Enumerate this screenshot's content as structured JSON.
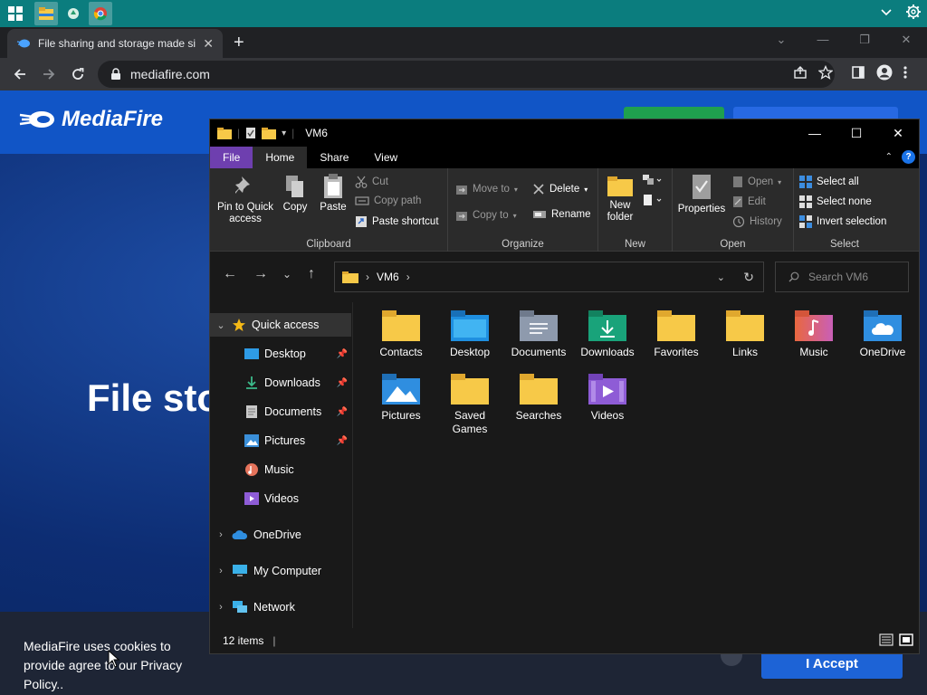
{
  "taskbar": {
    "apps": [
      {
        "name": "file-explorer",
        "active": true
      },
      {
        "name": "recycle",
        "active": false
      },
      {
        "name": "chrome",
        "active": true
      }
    ]
  },
  "browser": {
    "tab_title": "File sharing and storage made si",
    "url": "mediafire.com"
  },
  "page": {
    "logo_text": "MediaFire",
    "hero_title": "File sto",
    "cookie_text": "MediaFire uses cookies to provide agree to our Privacy Policy..",
    "accept_label": "I Accept"
  },
  "explorer": {
    "title": "VM6",
    "ribbon_tabs": [
      "File",
      "Home",
      "Share",
      "View"
    ],
    "clipboard": {
      "pin_label": "Pin to Quick access",
      "copy_label": "Copy",
      "paste_label": "Paste",
      "cut_label": "Cut",
      "copy_path_label": "Copy path",
      "paste_shortcut_label": "Paste shortcut",
      "group_label": "Clipboard"
    },
    "organize": {
      "move_to_label": "Move to",
      "copy_to_label": "Copy to",
      "delete_label": "Delete",
      "rename_label": "Rename",
      "group_label": "Organize"
    },
    "new": {
      "new_folder_label": "New folder",
      "group_label": "New"
    },
    "open": {
      "properties_label": "Properties",
      "open_label": "Open",
      "edit_label": "Edit",
      "history_label": "History",
      "group_label": "Open"
    },
    "select": {
      "select_all_label": "Select all",
      "select_none_label": "Select none",
      "invert_label": "Invert selection",
      "group_label": "Select"
    },
    "address": {
      "path": "VM6",
      "search_placeholder": "Search VM6"
    },
    "nav": [
      {
        "label": "Quick access",
        "selected": true
      },
      {
        "label": "Desktop"
      },
      {
        "label": "Downloads"
      },
      {
        "label": "Documents"
      },
      {
        "label": "Pictures"
      },
      {
        "label": "Music"
      },
      {
        "label": "Videos"
      },
      {
        "label": "OneDrive"
      },
      {
        "label": "My Computer"
      },
      {
        "label": "Network"
      }
    ],
    "items": [
      {
        "label": "Contacts",
        "icon": "contacts-folder-icon"
      },
      {
        "label": "Desktop",
        "icon": "desktop-folder-icon"
      },
      {
        "label": "Documents",
        "icon": "documents-folder-icon"
      },
      {
        "label": "Downloads",
        "icon": "downloads-folder-icon"
      },
      {
        "label": "Favorites",
        "icon": "favorites-folder-icon"
      },
      {
        "label": "Links",
        "icon": "links-folder-icon"
      },
      {
        "label": "Music",
        "icon": "music-folder-icon"
      },
      {
        "label": "OneDrive",
        "icon": "onedrive-folder-icon"
      },
      {
        "label": "Pictures",
        "icon": "pictures-folder-icon"
      },
      {
        "label": "Saved Games",
        "icon": "saved-games-folder-icon"
      },
      {
        "label": "Searches",
        "icon": "searches-folder-icon"
      },
      {
        "label": "Videos",
        "icon": "videos-folder-icon"
      }
    ],
    "status": "12 items"
  },
  "colors": {
    "taskbar": "#0b7d7e",
    "file_tab": "#6e3faf",
    "folder_yellow": "#f7c948",
    "mediafire_blue": "#1155c6"
  }
}
